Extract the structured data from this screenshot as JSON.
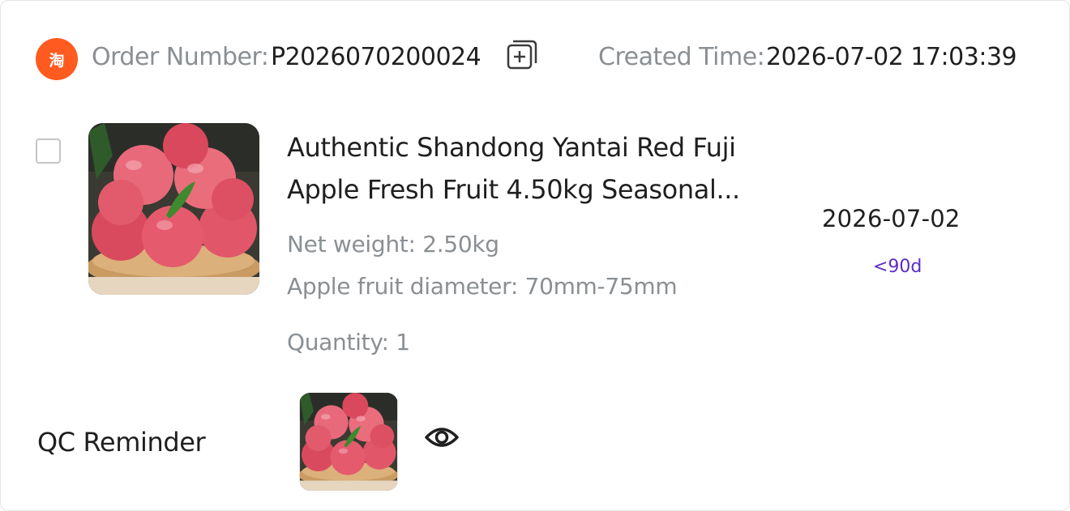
{
  "order": {
    "platform_badge": "淘",
    "platform_color": "#ff5a1f",
    "number_label": "Order Number:",
    "number_value": "P2026070200024",
    "copy_icon": "copy-add-icon",
    "created_label": "Created Time:",
    "created_value": "2026-07-02 17:03:39"
  },
  "item": {
    "checked": false,
    "title_line1": "Authentic Shandong Yantai Red Fuji",
    "title_line2": "Apple Fresh Fruit 4.50kg Seasonal...",
    "spec_weight": "Net weight: 2.50kg",
    "spec_diameter": "Apple fruit diameter: 70mm-75mm",
    "quantity": "Quantity: 1",
    "date": "2026-07-02",
    "age": "<90d",
    "age_color": "#5b2cc9"
  },
  "qc": {
    "label": "QC Reminder",
    "view_icon": "eye-icon"
  }
}
